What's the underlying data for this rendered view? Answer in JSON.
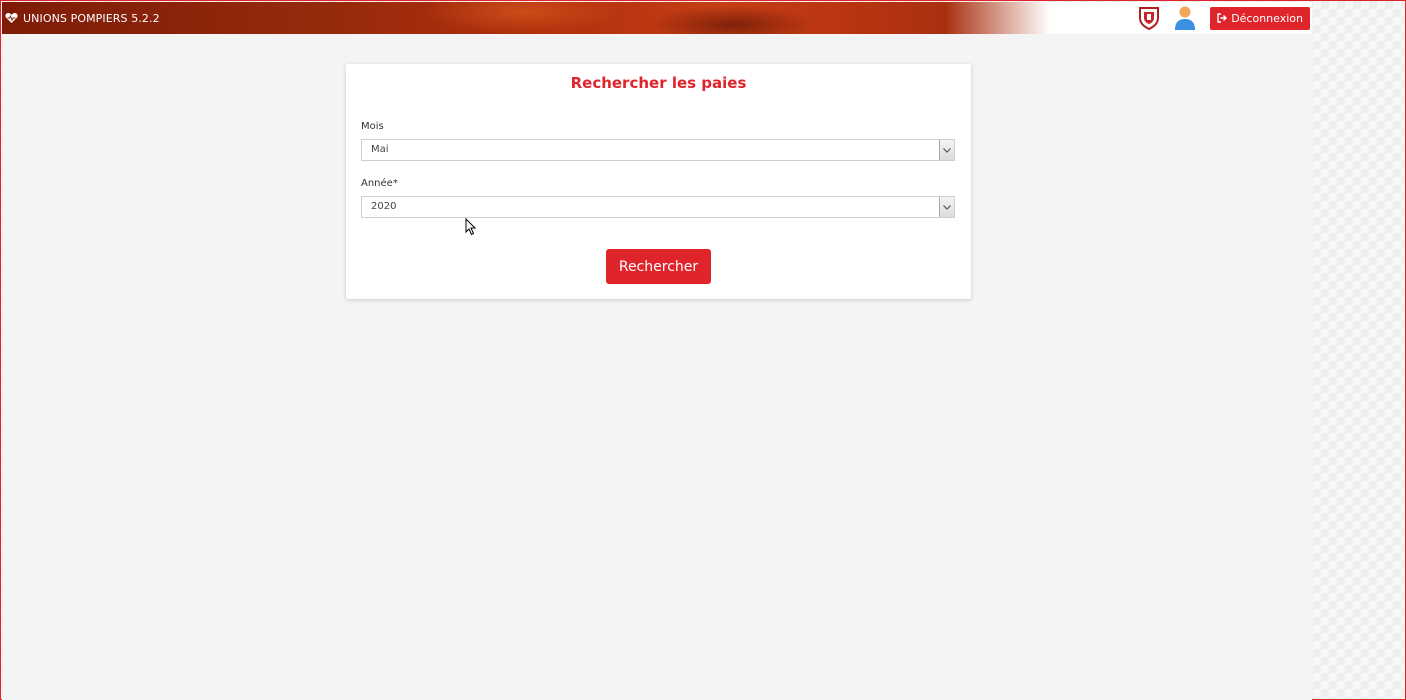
{
  "header": {
    "app_name": "UNIONS POMPIERS 5.2.2",
    "logout_label": "Déconnexion",
    "icons": [
      "heart-icon",
      "crest-icon",
      "user-avatar-icon",
      "logout-icon"
    ]
  },
  "form": {
    "title": "Rechercher les paies",
    "month_label": "Mois",
    "month_value": "Mai",
    "year_label": "Année*",
    "year_value": "2020",
    "submit_label": "Rechercher"
  },
  "colors": {
    "accent": "#e0242b",
    "header_dark": "#7e1c08",
    "page_bg": "#f4f4f4"
  }
}
